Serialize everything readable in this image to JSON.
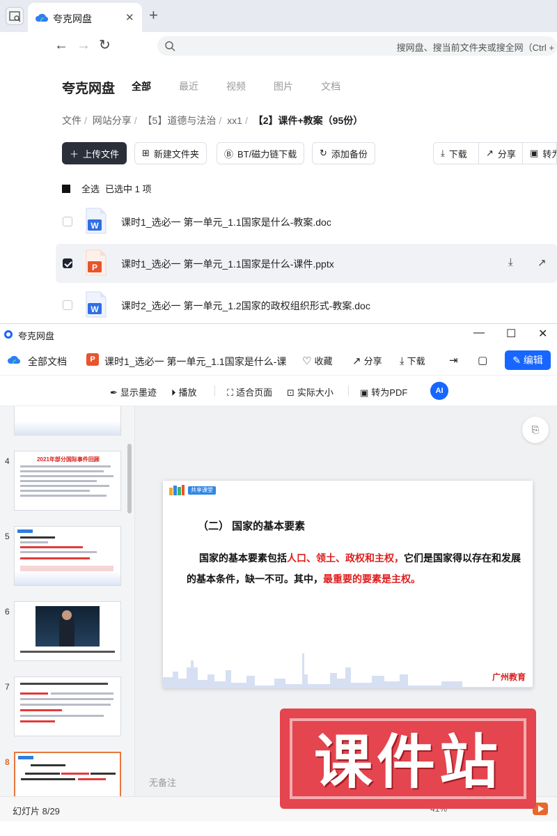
{
  "browser": {
    "tab_title": "夸克网盘",
    "address_placeholder": "搜网盘、搜当前文件夹或搜全网（Ctrl +"
  },
  "drive": {
    "brand": "夸克网盘",
    "tabs": [
      "全部",
      "最近",
      "视频",
      "图片",
      "文档"
    ],
    "breadcrumb": [
      "文件",
      "网站分享",
      "【5】道德与法治",
      "xx1",
      "【2】课件+教案（95份）"
    ],
    "buttons": {
      "upload": "上传文件",
      "new_folder": "新建文件夹",
      "bt": "BT/磁力链下载",
      "backup": "添加备份",
      "download": "下载",
      "share": "分享",
      "convert": "转为"
    },
    "select_all": "全选",
    "selected_text": "已选中  1  项",
    "files": [
      {
        "name": "课时1_选必一 第一单元_1.1国家是什么-教案.doc",
        "type": "word",
        "checked": false
      },
      {
        "name": "课时1_选必一 第一单元_1.1国家是什么-课件.pptx",
        "type": "ppt",
        "checked": true
      },
      {
        "name": "课时2_选必一 第一单元_1.2国家的政权组织形式-教案.doc",
        "type": "word",
        "checked": false
      }
    ]
  },
  "viewer": {
    "window_title": "夸克网盘",
    "all_docs": "全部文档",
    "file_name": "课时1_选必一 第一单元_1.1国家是什么-课",
    "favorite": "收藏",
    "share": "分享",
    "download": "下载",
    "edit": "编辑",
    "tools": {
      "ink": "显示墨迹",
      "play": "播放",
      "fit": "适合页面",
      "actual": "实际大小",
      "to_pdf": "转为PDF"
    },
    "thumbnails": [
      {
        "num": "4",
        "title": "2021年部分国际事件回顾"
      },
      {
        "num": "5",
        "title": "一、国家的本质"
      },
      {
        "num": "6",
        "title": ""
      },
      {
        "num": "7",
        "title": ""
      },
      {
        "num": "8",
        "title": "（二） 国家的基本要素"
      }
    ],
    "slide": {
      "badge": "共享课堂",
      "section": "（二）  国家的基本要素",
      "p1": "国家的基本要素包括",
      "p_red1": "人口、领土、政权和主权，",
      "p2": "它们是国家得以存在和发展的基本条件，缺一不可。其中，",
      "p_red2": "最重要的要素是主权。",
      "footer_logo": "广州教育"
    },
    "no_notes": "无备注",
    "slide_counter": "幻灯片 8/29",
    "zoom": "41%"
  },
  "watermark": "课件站"
}
